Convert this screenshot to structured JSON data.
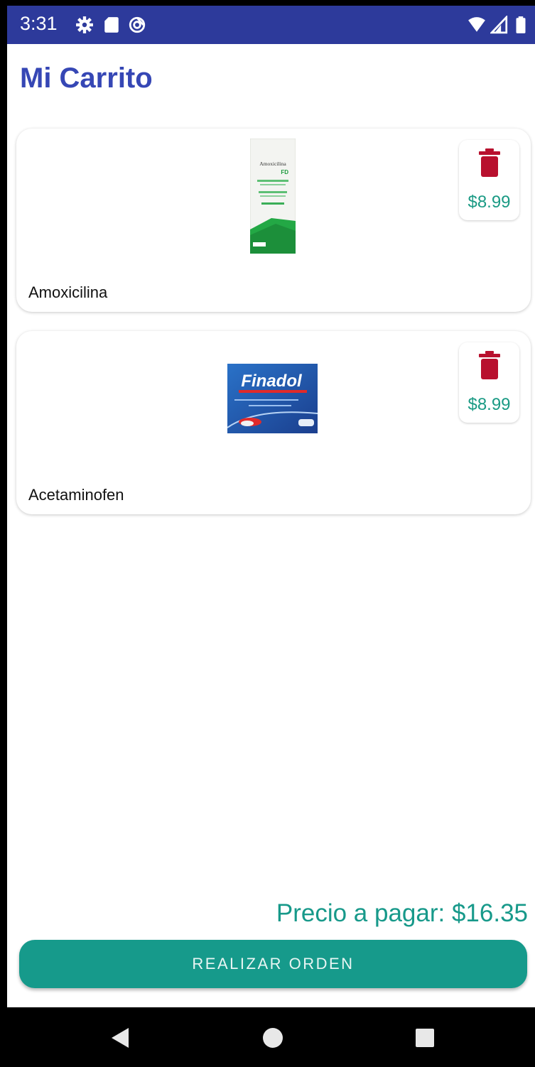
{
  "status_bar": {
    "time": "3:31",
    "icons": [
      "gear-icon",
      "sd-card-icon",
      "sync-icon",
      "wifi-icon",
      "signal-icon",
      "battery-icon"
    ]
  },
  "header": {
    "title": "Mi Carrito"
  },
  "cart": {
    "items": [
      {
        "name": "Amoxicilina",
        "price": "$8.99",
        "image_text": [
          "Amoxicilina",
          "FD"
        ]
      },
      {
        "name": "Acetaminofen",
        "price": "$8.99",
        "image_text": [
          "Finadol"
        ]
      }
    ]
  },
  "total": {
    "label": "Precio a pagar: $16.35"
  },
  "order_button": {
    "label": "REALIZAR ORDEN"
  },
  "colors": {
    "status_bar": "#2d3a9b",
    "title": "#3647b5",
    "accent": "#169a8b",
    "delete": "#b8102e"
  },
  "nav_icons": [
    "back-icon",
    "home-icon",
    "recents-icon"
  ]
}
